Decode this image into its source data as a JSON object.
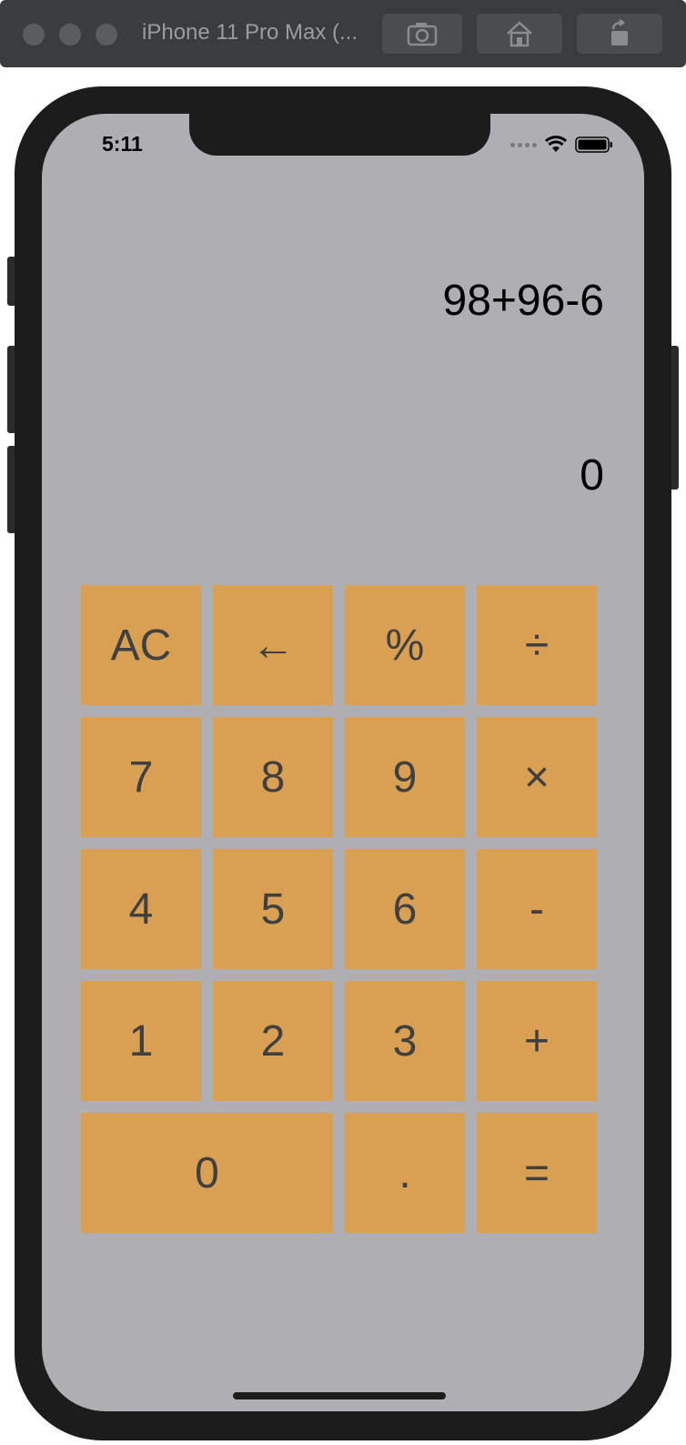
{
  "simulator": {
    "title": "iPhone 11 Pro Max (...",
    "buttons": [
      "screenshot-icon",
      "home-icon",
      "rotate-icon"
    ]
  },
  "status_bar": {
    "time": "5:11",
    "icons": [
      "signal-icon",
      "wifi-icon",
      "battery-icon"
    ]
  },
  "display": {
    "expression": "98+96-6",
    "result": "0"
  },
  "keys": [
    {
      "label": "AC",
      "name": "key-ac"
    },
    {
      "label": "←",
      "name": "key-backspace"
    },
    {
      "label": "%",
      "name": "key-percent"
    },
    {
      "label": "÷",
      "name": "key-divide"
    },
    {
      "label": "7",
      "name": "key-7"
    },
    {
      "label": "8",
      "name": "key-8"
    },
    {
      "label": "9",
      "name": "key-9"
    },
    {
      "label": "×",
      "name": "key-multiply"
    },
    {
      "label": "4",
      "name": "key-4"
    },
    {
      "label": "5",
      "name": "key-5"
    },
    {
      "label": "6",
      "name": "key-6"
    },
    {
      "label": "-",
      "name": "key-minus"
    },
    {
      "label": "1",
      "name": "key-1"
    },
    {
      "label": "2",
      "name": "key-2"
    },
    {
      "label": "3",
      "name": "key-3"
    },
    {
      "label": "+",
      "name": "key-plus"
    },
    {
      "label": "0",
      "name": "key-0"
    },
    {
      "label": ".",
      "name": "key-decimal"
    },
    {
      "label": "=",
      "name": "key-equals"
    }
  ],
  "colors": {
    "screen_background": "#afaeb3",
    "key_background": "#d9a053",
    "key_text": "#404040",
    "frame": "#1c1c1c"
  }
}
